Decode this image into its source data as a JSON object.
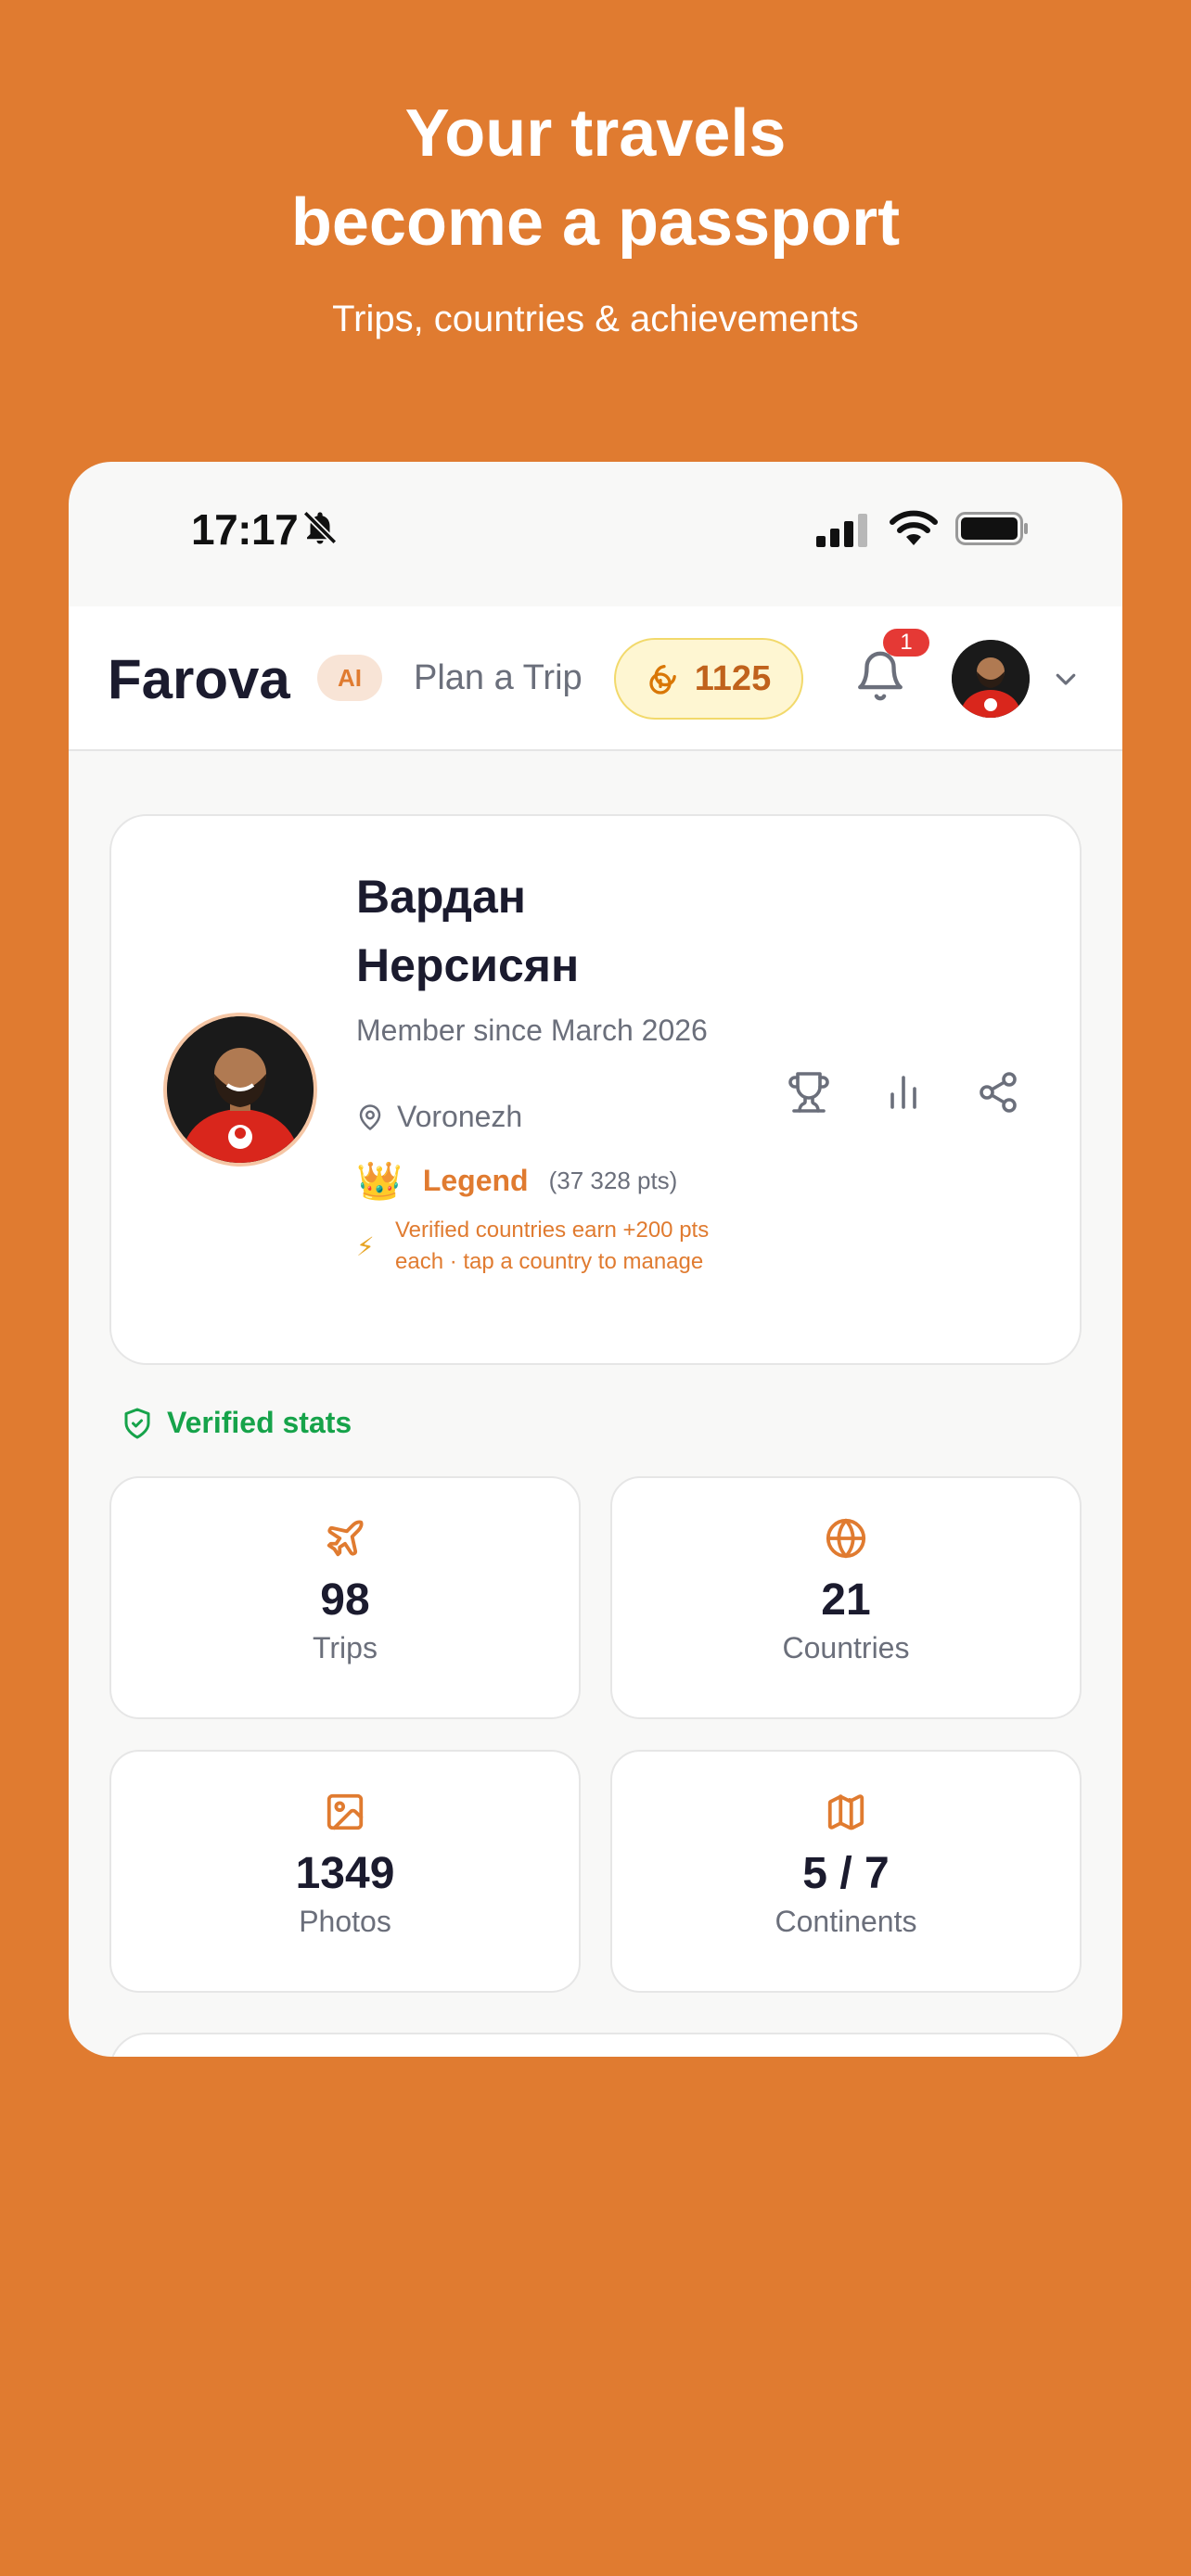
{
  "hero": {
    "title_line1": "Your travels",
    "title_line2": "become a passport",
    "subtitle": "Trips, countries & achievements"
  },
  "status_bar": {
    "time": "17:17",
    "icons": [
      "bell-off-icon",
      "signal-icon",
      "wifi-icon",
      "battery-icon"
    ]
  },
  "app_bar": {
    "logo": "Farova",
    "ai_badge": "AI",
    "plan_link": "Plan a Trip",
    "coins": "1125",
    "notifications_count": "1"
  },
  "profile": {
    "name": "Вардан Нерсисян",
    "member_since": "Member since March 2026",
    "location": "Voronezh",
    "rank_icon": "👑",
    "rank": "Legend",
    "points": "(37 328 pts)",
    "hint_icon": "⚡",
    "hint": "Verified countries earn +200 pts each · tap a country to manage",
    "actions": [
      "trophy-icon",
      "chart-icon",
      "share-icon"
    ]
  },
  "verified_label": "Verified stats",
  "stats": [
    {
      "icon": "plane-icon",
      "value": "98",
      "label": "Trips"
    },
    {
      "icon": "globe-icon",
      "value": "21",
      "label": "Countries"
    },
    {
      "icon": "image-icon",
      "value": "1349",
      "label": "Photos"
    },
    {
      "icon": "map-icon",
      "value": "5 / 7",
      "label": "Continents"
    }
  ],
  "colors": {
    "background": "#E07B30",
    "accent": "#E07B30",
    "verified": "#16A34A",
    "text_dark": "#1B1B2E",
    "text_muted": "#6B6F7B"
  }
}
